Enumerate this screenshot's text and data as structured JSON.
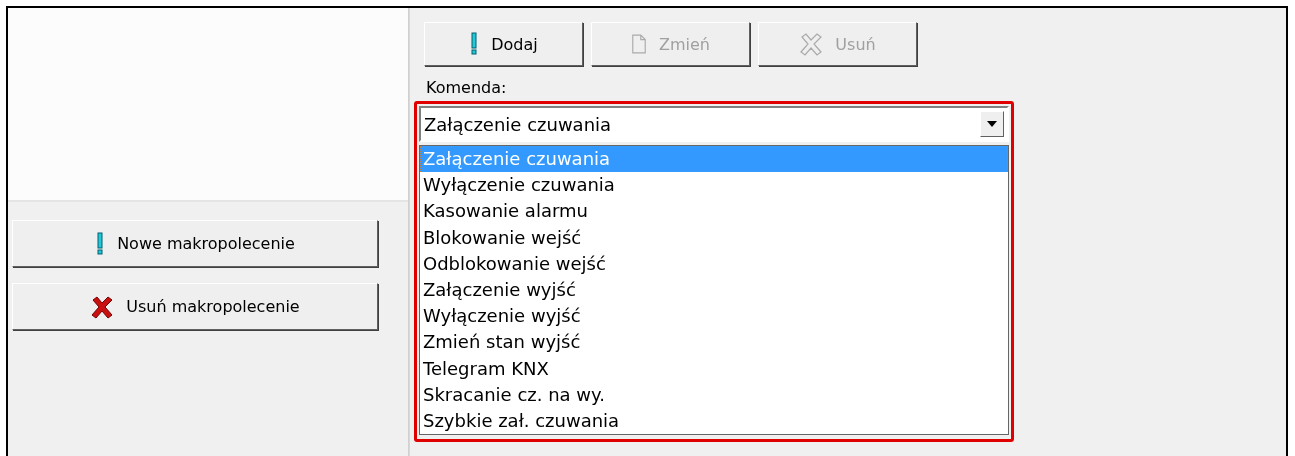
{
  "left_panel": {
    "buttons": [
      {
        "label": "Nowe makropolecenie",
        "kind": "exclamation"
      },
      {
        "label": "Usuń makropolecenie",
        "kind": "cross"
      }
    ]
  },
  "toolbar": [
    {
      "label": "Dodaj",
      "kind": "exclamation",
      "disabled": false
    },
    {
      "label": "Zmień",
      "kind": "page",
      "disabled": true
    },
    {
      "label": "Usuń",
      "kind": "cross",
      "disabled": true
    }
  ],
  "command": {
    "label": "Komenda:",
    "value": "Załączenie czuwania",
    "options": [
      {
        "label": "Załączenie czuwania",
        "selected": true
      },
      {
        "label": "Wyłączenie czuwania",
        "selected": false
      },
      {
        "label": "Kasowanie alarmu",
        "selected": false
      },
      {
        "label": "Blokowanie wejść",
        "selected": false
      },
      {
        "label": "Odblokowanie wejść",
        "selected": false
      },
      {
        "label": "Załączenie wyjść",
        "selected": false
      },
      {
        "label": "Wyłączenie wyjść",
        "selected": false
      },
      {
        "label": "Zmień stan wyjść",
        "selected": false
      },
      {
        "label": "Telegram KNX",
        "selected": false
      },
      {
        "label": "Skracanie cz. na wy.",
        "selected": false
      },
      {
        "label": "Szybkie zał. czuwania",
        "selected": false
      }
    ]
  }
}
